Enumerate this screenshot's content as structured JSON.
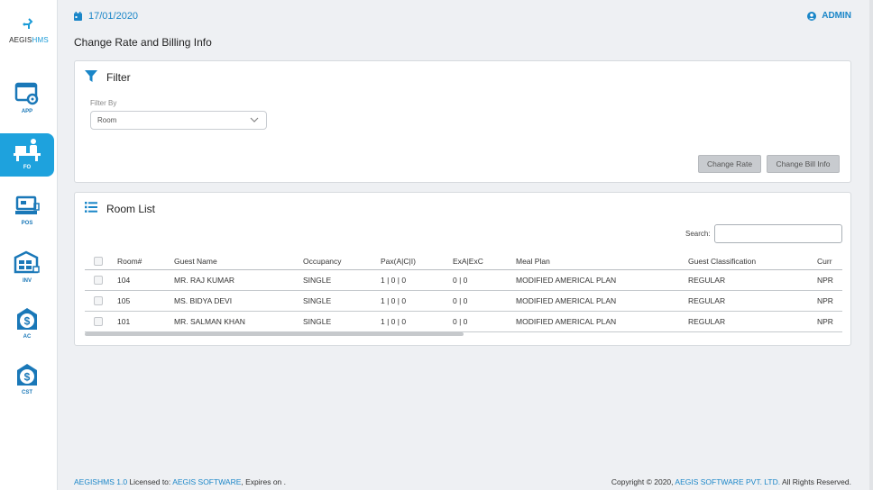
{
  "app": {
    "logo_left": "AEGIS",
    "logo_right": "HMS"
  },
  "sidebar": {
    "items": [
      {
        "label": "APP",
        "icon": "app-settings-icon"
      },
      {
        "label": "FO",
        "icon": "front-office-icon",
        "active": true
      },
      {
        "label": "POS",
        "icon": "pos-register-icon"
      },
      {
        "label": "INV",
        "icon": "inventory-icon"
      },
      {
        "label": "AC",
        "icon": "accounts-dollar-icon"
      },
      {
        "label": "CST",
        "icon": "cost-dollar-icon"
      }
    ]
  },
  "header": {
    "date": "17/01/2020",
    "user": "ADMIN"
  },
  "page": {
    "title": "Change Rate and Billing Info"
  },
  "filter": {
    "title": "Filter",
    "filter_by_label": "Filter By",
    "selected": "Room",
    "change_rate_label": "Change Rate",
    "change_bill_label": "Change Bill Info"
  },
  "room_list": {
    "title": "Room List",
    "search_label": "Search:",
    "search_value": "",
    "columns": [
      "Room#",
      "Guest Name",
      "Occupancy",
      "Pax(A|C|I)",
      "ExA|ExC",
      "Meal Plan",
      "Guest Classification",
      "Curr"
    ],
    "rows": [
      [
        "104",
        "MR. RAJ KUMAR",
        "SINGLE",
        "1 | 0 | 0",
        "0 | 0",
        "MODIFIED AMERICAL PLAN",
        "REGULAR",
        "NPR"
      ],
      [
        "105",
        "MS. BIDYA DEVI",
        "SINGLE",
        "1 | 0 | 0",
        "0 | 0",
        "MODIFIED AMERICAL PLAN",
        "REGULAR",
        "NPR"
      ],
      [
        "101",
        "MR. SALMAN KHAN",
        "SINGLE",
        "1 | 0 | 0",
        "0 | 0",
        "MODIFIED AMERICAL PLAN",
        "REGULAR",
        "NPR"
      ]
    ]
  },
  "footer": {
    "product": "AEGISHMS 1.0",
    "licensed_to_label": "Licensed to:",
    "licensee": "AEGIS SOFTWARE",
    "expires": ", Expires on .",
    "copyright_prefix": "Copyright © 2020,",
    "company": "AEGIS SOFTWARE PVT. LTD.",
    "rights": "All Rights Reserved."
  },
  "colors": {
    "accent": "#1a86c8",
    "sidebar_active": "#1ea2dd",
    "button_disabled": "#c8cbcf"
  }
}
